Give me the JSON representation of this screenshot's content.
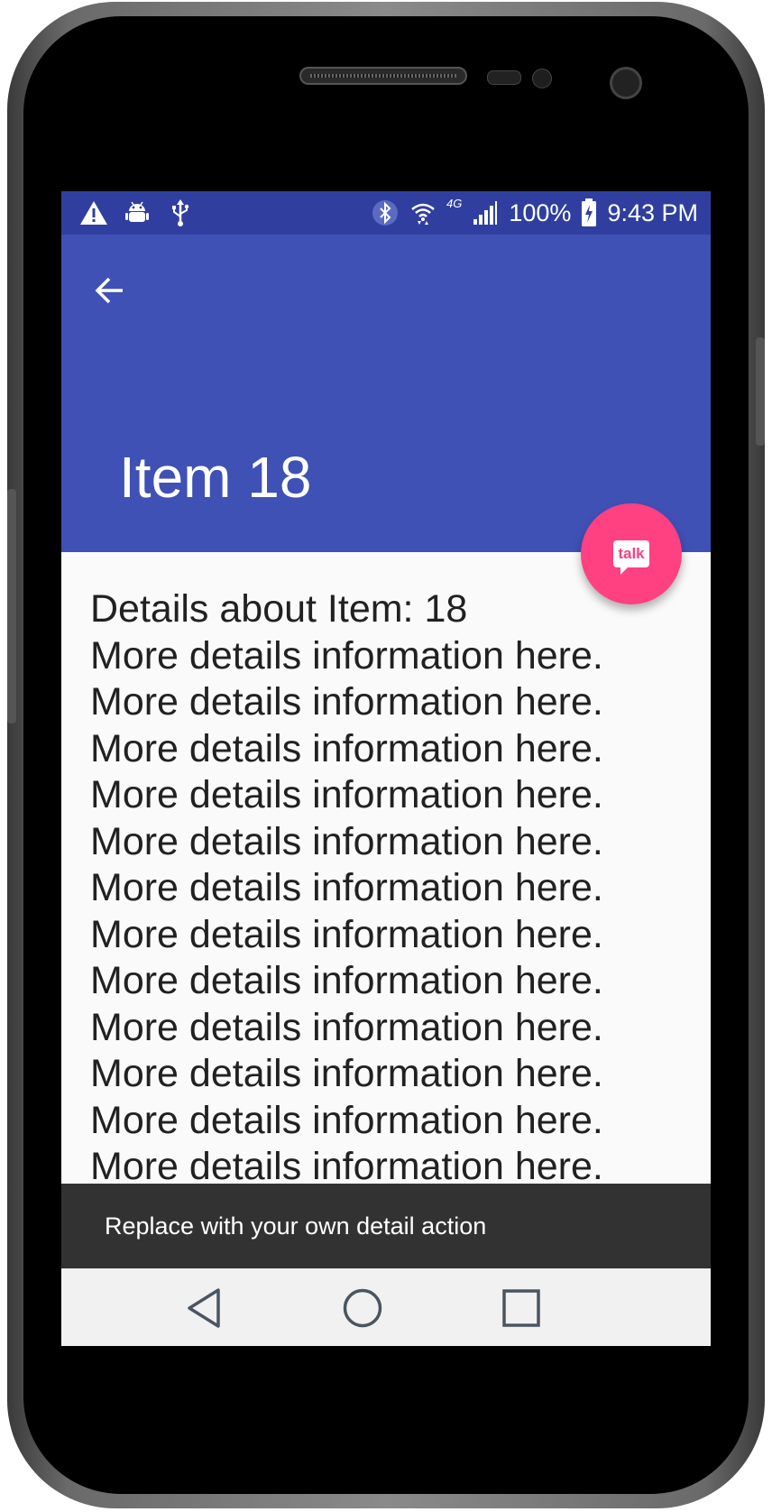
{
  "status_bar": {
    "battery_text": "100%",
    "time": "9:43 PM",
    "network_label": "4G",
    "icons_left": [
      "warning-icon",
      "android-debug-icon",
      "usb-icon"
    ],
    "icons_right": [
      "bluetooth-icon",
      "wifi-icon",
      "cellular-signal-icon",
      "battery-charging-icon"
    ]
  },
  "app_bar": {
    "title": "Item 18",
    "color": "#3F51B5",
    "status_color": "#303F9F"
  },
  "fab": {
    "label": "talk",
    "color": "#FF4081"
  },
  "content": {
    "heading": "Details about Item: 18",
    "lines": [
      "More details information here.",
      "More details information here.",
      "More details information here.",
      "More details information here.",
      "More details information here.",
      "More details information here.",
      "More details information here.",
      "More details information here.",
      "More details information here.",
      "More details information here.",
      "More details information here.",
      "More details information here."
    ]
  },
  "snackbar": {
    "message": "Replace with your own detail action"
  },
  "nav_bar": {
    "buttons": [
      "back-triangle-icon",
      "home-circle-icon",
      "recents-square-icon"
    ]
  }
}
